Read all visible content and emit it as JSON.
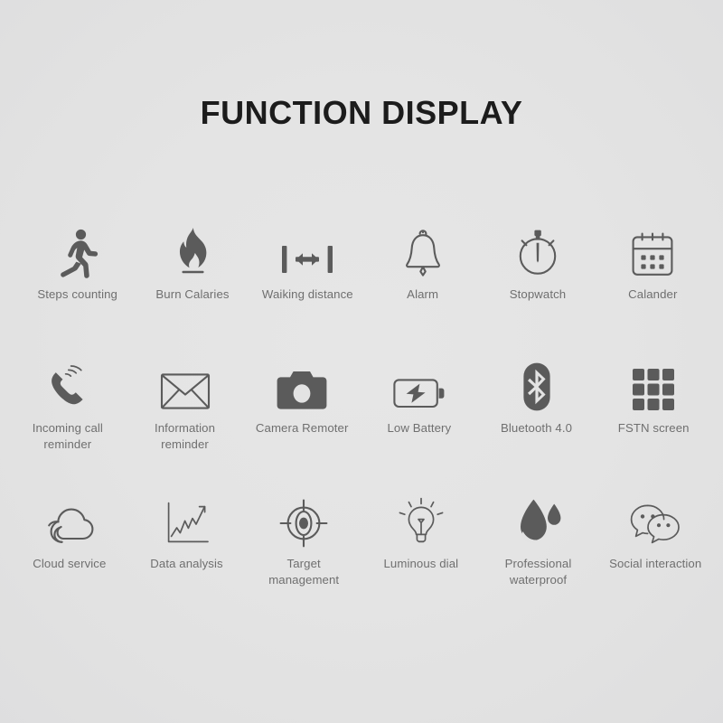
{
  "page": {
    "title": "FUNCTION DISPLAY",
    "background_color": "#e2e2e2",
    "title_color": "#1c1c1c",
    "label_color": "#6f6f6f",
    "icon_color": "#5b5b5b"
  },
  "rows": [
    {
      "items": [
        {
          "label": "Steps counting",
          "icon": "running-person-icon"
        },
        {
          "label": "Burn Calaries",
          "icon": "flame-icon"
        },
        {
          "label": "Waiking distance",
          "icon": "distance-measure-icon"
        },
        {
          "label": "Alarm",
          "icon": "bell-icon"
        },
        {
          "label": "Stopwatch",
          "icon": "stopwatch-icon"
        },
        {
          "label": "Calander",
          "icon": "calendar-icon"
        }
      ]
    },
    {
      "items": [
        {
          "label": "Incoming call\nreminder",
          "icon": "phone-ringing-icon"
        },
        {
          "label": "Information\nreminder",
          "icon": "envelope-icon"
        },
        {
          "label": "Camera Remoter",
          "icon": "camera-icon"
        },
        {
          "label": "Low Battery",
          "icon": "battery-bolt-icon"
        },
        {
          "label": "Bluetooth 4.0",
          "icon": "bluetooth-icon"
        },
        {
          "label": "FSTN screen",
          "icon": "grid-squares-icon"
        }
      ]
    },
    {
      "items": [
        {
          "label": "Cloud service",
          "icon": "cloud-icon"
        },
        {
          "label": "Data analysis",
          "icon": "line-chart-icon"
        },
        {
          "label": "Target\nmanagement",
          "icon": "crosshair-target-icon"
        },
        {
          "label": "Luminous dial",
          "icon": "light-bulb-icon"
        },
        {
          "label": "Professional\nwaterproof",
          "icon": "water-drop-icon"
        },
        {
          "label": "Social interaction",
          "icon": "chat-bubbles-icon"
        }
      ]
    }
  ]
}
